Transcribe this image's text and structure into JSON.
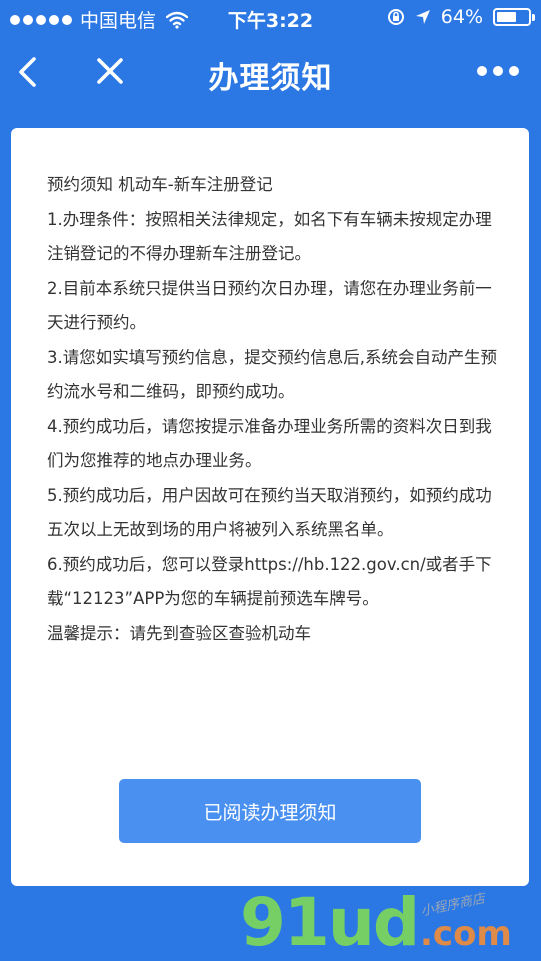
{
  "status_bar": {
    "carrier": "中国电信",
    "time": "下午3:22",
    "battery_text": "64%",
    "battery_level": 0.64
  },
  "nav": {
    "title": "办理须知"
  },
  "notice": {
    "lines": [
      "预约须知 机动车-新车注册登记",
      "1.办理条件：按照相关法律规定，如名下有车辆未按规定办理注销登记的不得办理新车注册登记。",
      "2.目前本系统只提供当日预约次日办理，请您在办理业务前一天进行预约。",
      "3.请您如实填写预约信息，提交预约信息后,系统会自动产生预约流水号和二维码，即预约成功。",
      "4.预约成功后，请您按提示准备办理业务所需的资料次日到我们为您推荐的地点办理业务。",
      "5.预约成功后，用户因故可在预约当天取消预约，如预约成功五次以上无故到场的用户将被列入系统黑名单。",
      "6.预约成功后，您可以登录https://hb.122.gov.cn/或者手下载“12123”APP为您的车辆提前预选车牌号。",
      "温馨提示：请先到查验区查验机动车"
    ],
    "button_label": "已阅读办理须知"
  },
  "watermark": {
    "main": "91ud",
    "domain": ".com",
    "tagline": "小程序商店"
  },
  "colors": {
    "background": "#2b78e4",
    "button": "#4a90f0",
    "card": "#ffffff",
    "text": "#333333"
  }
}
